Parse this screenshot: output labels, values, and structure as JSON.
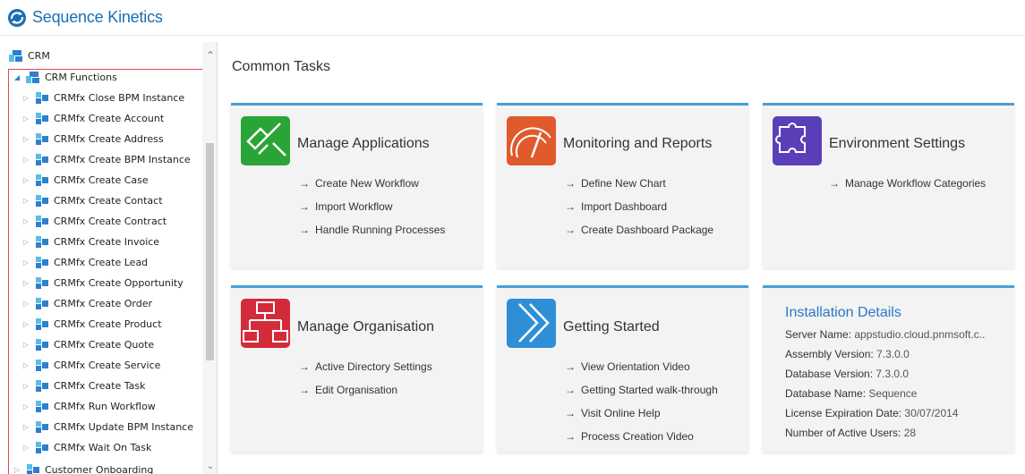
{
  "header": {
    "brand": "Sequence Kinetics"
  },
  "tree": {
    "root": "CRM",
    "group": "CRM Functions",
    "items": [
      "CRMfx Close BPM Instance",
      "CRMfx Create Account",
      "CRMfx Create Address",
      "CRMfx Create BPM Instance",
      "CRMfx Create Case",
      "CRMfx Create Contact",
      "CRMfx Create Contract",
      "CRMfx Create Invoice",
      "CRMfx Create Lead",
      "CRMfx Create Opportunity",
      "CRMfx Create Order",
      "CRMfx Create Product",
      "CRMfx Create Quote",
      "CRMfx Create Service",
      "CRMfx Create Task",
      "CRMfx Run Workflow",
      "CRMfx Update BPM Instance",
      "CRMfx Wait On Task"
    ],
    "next": "Customer Onboarding"
  },
  "main": {
    "title": "Common Tasks",
    "cards": {
      "manage_apps": {
        "title": "Manage Applications",
        "links": [
          "Create New Workflow",
          "Import Workflow",
          "Handle Running Processes"
        ],
        "color": "#2aa436"
      },
      "monitoring": {
        "title": "Monitoring and Reports",
        "links": [
          "Define New Chart",
          "Import Dashboard",
          "Create Dashboard Package"
        ],
        "color": "#e05a2b"
      },
      "environment": {
        "title": "Environment Settings",
        "links": [
          "Manage Workflow Categories"
        ],
        "color": "#5b3fb8"
      },
      "manage_org": {
        "title": "Manage Organisation",
        "links": [
          "Active Directory Settings",
          "Edit Organisation"
        ],
        "color": "#d42b3a"
      },
      "getting_started": {
        "title": "Getting Started",
        "links": [
          "View Orientation Video",
          "Getting Started walk-through",
          "Visit Online Help",
          "Process Creation Video"
        ],
        "color": "#2f8fd6"
      }
    },
    "install": {
      "title": "Installation Details",
      "rows": [
        {
          "k": "Server Name:",
          "v": "appstudio.cloud.pnmsoft.c.."
        },
        {
          "k": "Assembly Version:",
          "v": "7.3.0.0"
        },
        {
          "k": "Database Version:",
          "v": "7.3.0.0"
        },
        {
          "k": "Database Name:",
          "v": "Sequence"
        },
        {
          "k": "License Expiration Date:",
          "v": "30/07/2014"
        },
        {
          "k": "Number of Active Users:",
          "v": "28"
        }
      ]
    }
  },
  "colors": {
    "brand": "#1b6fb3",
    "accent": "#4a9ed9",
    "highlight": "#e0474c"
  },
  "icons": {
    "arrow": "→",
    "expanded": "◢",
    "collapsed": "▷",
    "scroll_up": "⌃",
    "scroll_down": "⌄"
  }
}
